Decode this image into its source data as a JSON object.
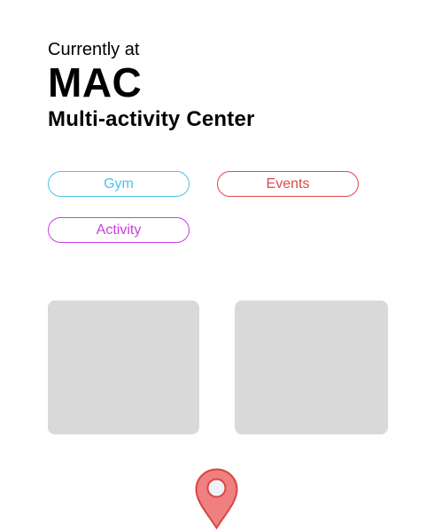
{
  "header": {
    "status_label": "Currently at",
    "location_code": "MAC",
    "location_name": "Multi-activity Center"
  },
  "filters": [
    {
      "label": "Gym",
      "color": "#4cc3e6"
    },
    {
      "label": "Events",
      "color": "#e04848"
    },
    {
      "label": "Activity",
      "color": "#c93fe0"
    }
  ],
  "cards": [
    {
      "placeholder_color": "#d9d9d9"
    },
    {
      "placeholder_color": "#d9d9d9"
    }
  ],
  "map_pin": {
    "icon": "map-pin-icon",
    "fill": "#f07f7f",
    "stroke": "#d64545"
  }
}
